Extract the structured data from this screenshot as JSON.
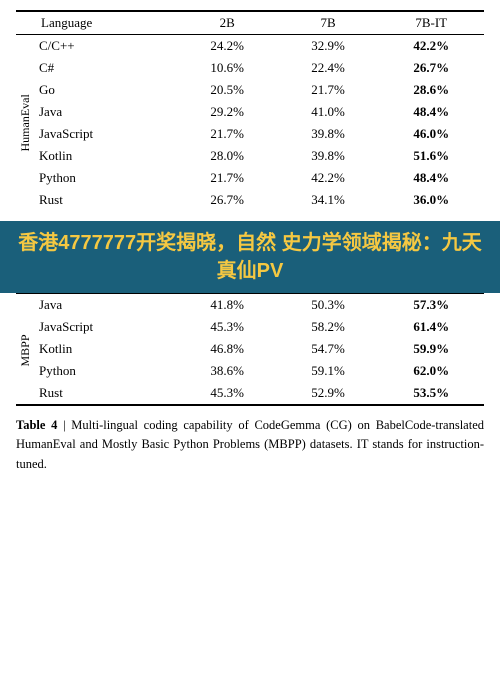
{
  "table": {
    "headers": [
      "Language",
      "2B",
      "7B",
      "7B-IT"
    ],
    "humaneval_label": "HumanEval",
    "mbpp_label": "MBPP",
    "humaneval_rows": [
      {
        "lang": "C/C++",
        "b2": "24.2%",
        "b7": "32.9%",
        "b7it": "42.2%"
      },
      {
        "lang": "C#",
        "b2": "10.6%",
        "b7": "22.4%",
        "b7it": "26.7%"
      },
      {
        "lang": "Go",
        "b2": "20.5%",
        "b7": "21.7%",
        "b7it": "28.6%"
      },
      {
        "lang": "Java",
        "b2": "29.2%",
        "b7": "41.0%",
        "b7it": "48.4%"
      },
      {
        "lang": "JavaScript",
        "b2": "21.7%",
        "b7": "39.8%",
        "b7it": "46.0%"
      },
      {
        "lang": "Kotlin",
        "b2": "28.0%",
        "b7": "39.8%",
        "b7it": "51.6%"
      },
      {
        "lang": "Python",
        "b2": "21.7%",
        "b7": "42.2%",
        "b7it": "48.4%"
      },
      {
        "lang": "Rust",
        "b2": "26.7%",
        "b7": "34.1%",
        "b7it": "36.0%"
      }
    ],
    "mbpp_rows": [
      {
        "lang": "Java",
        "b2": "41.8%",
        "b7": "50.3%",
        "b7it": "57.3%"
      },
      {
        "lang": "JavaScript",
        "b2": "45.3%",
        "b7": "58.2%",
        "b7it": "61.4%"
      },
      {
        "lang": "Kotlin",
        "b2": "46.8%",
        "b7": "54.7%",
        "b7it": "59.9%"
      },
      {
        "lang": "Python",
        "b2": "38.6%",
        "b7": "59.1%",
        "b7it": "62.0%"
      },
      {
        "lang": "Rust",
        "b2": "45.3%",
        "b7": "52.9%",
        "b7it": "53.5%"
      }
    ]
  },
  "overlay": {
    "text": "香港4777777开奖揭晓，自然\n史力学领域揭秘：九天真仙PV"
  },
  "caption": {
    "label": "Table 4",
    "separator": " | ",
    "text": "Multi-lingual coding capability of CodeGemma (CG) on BabelCode-translated HumanEval and Mostly Basic Python Problems (MBPP) datasets. IT stands for instruction-tuned."
  }
}
